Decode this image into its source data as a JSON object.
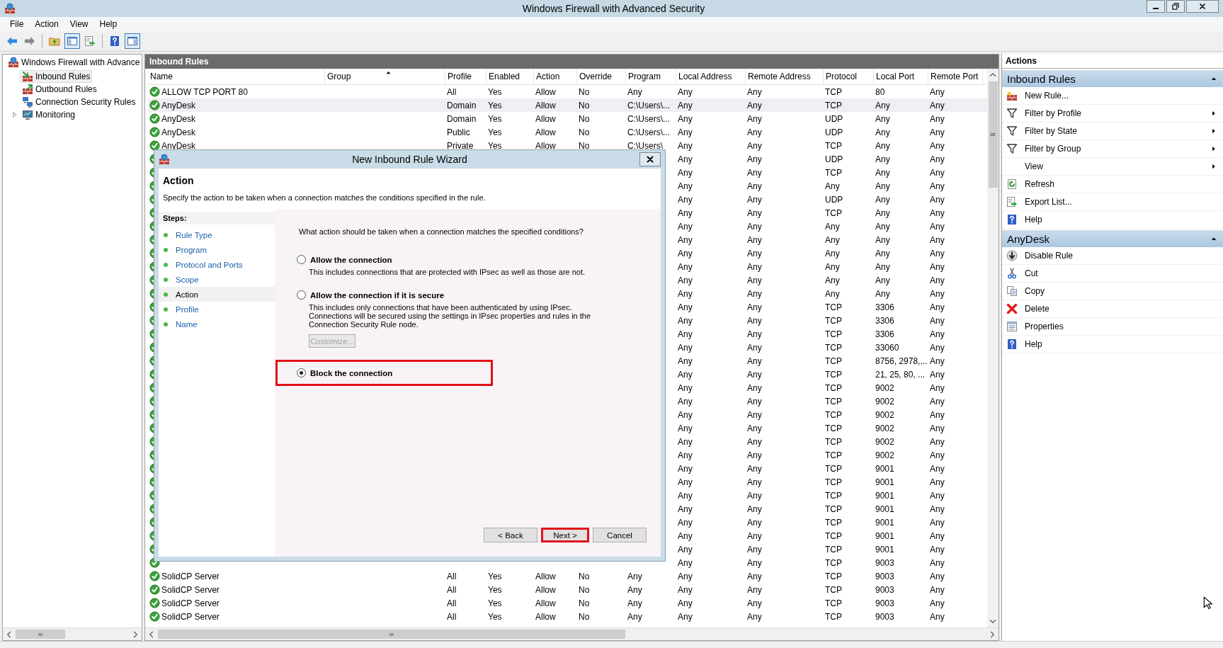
{
  "window": {
    "title": "Windows Firewall with Advanced Security"
  },
  "menu": [
    "File",
    "Action",
    "View",
    "Help"
  ],
  "toolbar": [
    [
      {
        "kind": "back",
        "pressed": false
      },
      {
        "kind": "forward",
        "pressed": false
      }
    ],
    [
      {
        "kind": "folder",
        "pressed": false
      },
      {
        "kind": "console-tree",
        "pressed": true
      },
      {
        "kind": "export",
        "pressed": false
      }
    ],
    [
      {
        "kind": "help",
        "pressed": false
      },
      {
        "kind": "action-pane",
        "pressed": true
      }
    ]
  ],
  "tree": [
    {
      "label": "Windows Firewall with Advance",
      "kind": "firewall",
      "selected": false,
      "children": [
        {
          "label": "Inbound Rules",
          "kind": "inbound",
          "selected": true,
          "expandable": false
        },
        {
          "label": "Outbound Rules",
          "kind": "outbound",
          "selected": false,
          "expandable": false
        },
        {
          "label": "Connection Security Rules",
          "kind": "security",
          "selected": false,
          "expandable": false
        },
        {
          "label": "Monitoring",
          "kind": "monitor",
          "selected": false,
          "expandable": true
        }
      ]
    }
  ],
  "table": {
    "title": "Inbound Rules",
    "columns": [
      {
        "label": "Name",
        "sorted": false
      },
      {
        "label": "Group",
        "sorted": true
      },
      {
        "label": "Profile",
        "sorted": false
      },
      {
        "label": "Enabled",
        "sorted": false
      },
      {
        "label": "Action",
        "sorted": false
      },
      {
        "label": "Override",
        "sorted": false
      },
      {
        "label": "Program",
        "sorted": false
      },
      {
        "label": "Local Address",
        "sorted": false
      },
      {
        "label": "Remote Address",
        "sorted": false
      },
      {
        "label": "Protocol",
        "sorted": false
      },
      {
        "label": "Local Port",
        "sorted": false
      },
      {
        "label": "Remote Port",
        "sorted": false
      }
    ],
    "rows": [
      {
        "name": "ALLOW TCP PORT 80",
        "profile": "All",
        "enabled": "Yes",
        "action": "Allow",
        "override": "No",
        "program": "Any",
        "local_address": "Any",
        "remote_address": "Any",
        "protocol": "TCP",
        "local_port": "80",
        "remote_port": "Any",
        "selected": false
      },
      {
        "name": "AnyDesk",
        "profile": "Domain",
        "enabled": "Yes",
        "action": "Allow",
        "override": "No",
        "program": "C:\\Users\\...",
        "local_address": "Any",
        "remote_address": "Any",
        "protocol": "TCP",
        "local_port": "Any",
        "remote_port": "Any",
        "selected": true
      },
      {
        "name": "AnyDesk",
        "profile": "Domain",
        "enabled": "Yes",
        "action": "Allow",
        "override": "No",
        "program": "C:\\Users\\...",
        "local_address": "Any",
        "remote_address": "Any",
        "protocol": "UDP",
        "local_port": "Any",
        "remote_port": "Any",
        "selected": false
      },
      {
        "name": "AnyDesk",
        "profile": "Public",
        "enabled": "Yes",
        "action": "Allow",
        "override": "No",
        "program": "C:\\Users\\...",
        "local_address": "Any",
        "remote_address": "Any",
        "protocol": "UDP",
        "local_port": "Any",
        "remote_port": "Any",
        "selected": false
      },
      {
        "name": "AnyDesk",
        "profile": "Private",
        "enabled": "Yes",
        "action": "Allow",
        "override": "No",
        "program": "C:\\Users\\",
        "local_address": "Any",
        "remote_address": "Any",
        "protocol": "TCP",
        "local_port": "Any",
        "remote_port": "Any",
        "selected": false
      },
      {
        "local_address": "Any",
        "remote_address": "Any",
        "protocol": "UDP",
        "local_port": "Any",
        "remote_port": "Any",
        "selected": false
      },
      {
        "local_address": "Any",
        "remote_address": "Any",
        "protocol": "TCP",
        "local_port": "Any",
        "remote_port": "Any",
        "selected": false
      },
      {
        "local_address": "Any",
        "remote_address": "Any",
        "protocol": "Any",
        "local_port": "Any",
        "remote_port": "Any",
        "selected": false
      },
      {
        "local_address": "Any",
        "remote_address": "Any",
        "protocol": "UDP",
        "local_port": "Any",
        "remote_port": "Any",
        "selected": false
      },
      {
        "local_address": "Any",
        "remote_address": "Any",
        "protocol": "TCP",
        "local_port": "Any",
        "remote_port": "Any",
        "selected": false
      },
      {
        "local_address": "Any",
        "remote_address": "Any",
        "protocol": "Any",
        "local_port": "Any",
        "remote_port": "Any",
        "selected": false
      },
      {
        "local_address": "Any",
        "remote_address": "Any",
        "protocol": "Any",
        "local_port": "Any",
        "remote_port": "Any",
        "selected": false
      },
      {
        "local_address": "Any",
        "remote_address": "Any",
        "protocol": "Any",
        "local_port": "Any",
        "remote_port": "Any",
        "selected": false
      },
      {
        "local_address": "Any",
        "remote_address": "Any",
        "protocol": "Any",
        "local_port": "Any",
        "remote_port": "Any",
        "selected": false
      },
      {
        "local_address": "Any",
        "remote_address": "Any",
        "protocol": "Any",
        "local_port": "Any",
        "remote_port": "Any",
        "selected": false
      },
      {
        "local_address": "Any",
        "remote_address": "Any",
        "protocol": "Any",
        "local_port": "Any",
        "remote_port": "Any",
        "selected": false
      },
      {
        "local_address": "Any",
        "remote_address": "Any",
        "protocol": "TCP",
        "local_port": "3306",
        "remote_port": "Any",
        "selected": false
      },
      {
        "local_address": "Any",
        "remote_address": "Any",
        "protocol": "TCP",
        "local_port": "3306",
        "remote_port": "Any",
        "selected": false
      },
      {
        "local_address": "Any",
        "remote_address": "Any",
        "protocol": "TCP",
        "local_port": "3306",
        "remote_port": "Any",
        "selected": false
      },
      {
        "local_address": "Any",
        "remote_address": "Any",
        "protocol": "TCP",
        "local_port": "33060",
        "remote_port": "Any",
        "selected": false
      },
      {
        "local_address": "Any",
        "remote_address": "Any",
        "protocol": "TCP",
        "local_port": "8756, 2978,...",
        "remote_port": "Any",
        "selected": false
      },
      {
        "local_address": "Any",
        "remote_address": "Any",
        "protocol": "TCP",
        "local_port": "21, 25, 80, ...",
        "remote_port": "Any",
        "selected": false
      },
      {
        "local_address": "Any",
        "remote_address": "Any",
        "protocol": "TCP",
        "local_port": "9002",
        "remote_port": "Any",
        "selected": false
      },
      {
        "local_address": "Any",
        "remote_address": "Any",
        "protocol": "TCP",
        "local_port": "9002",
        "remote_port": "Any",
        "selected": false
      },
      {
        "local_address": "Any",
        "remote_address": "Any",
        "protocol": "TCP",
        "local_port": "9002",
        "remote_port": "Any",
        "selected": false
      },
      {
        "local_address": "Any",
        "remote_address": "Any",
        "protocol": "TCP",
        "local_port": "9002",
        "remote_port": "Any",
        "selected": false
      },
      {
        "local_address": "Any",
        "remote_address": "Any",
        "protocol": "TCP",
        "local_port": "9002",
        "remote_port": "Any",
        "selected": false
      },
      {
        "local_address": "Any",
        "remote_address": "Any",
        "protocol": "TCP",
        "local_port": "9002",
        "remote_port": "Any",
        "selected": false
      },
      {
        "local_address": "Any",
        "remote_address": "Any",
        "protocol": "TCP",
        "local_port": "9001",
        "remote_port": "Any",
        "selected": false
      },
      {
        "local_address": "Any",
        "remote_address": "Any",
        "protocol": "TCP",
        "local_port": "9001",
        "remote_port": "Any",
        "selected": false
      },
      {
        "local_address": "Any",
        "remote_address": "Any",
        "protocol": "TCP",
        "local_port": "9001",
        "remote_port": "Any",
        "selected": false
      },
      {
        "local_address": "Any",
        "remote_address": "Any",
        "protocol": "TCP",
        "local_port": "9001",
        "remote_port": "Any",
        "selected": false
      },
      {
        "local_address": "Any",
        "remote_address": "Any",
        "protocol": "TCP",
        "local_port": "9001",
        "remote_port": "Any",
        "selected": false
      },
      {
        "local_address": "Any",
        "remote_address": "Any",
        "protocol": "TCP",
        "local_port": "9001",
        "remote_port": "Any",
        "selected": false
      },
      {
        "local_address": "Any",
        "remote_address": "Any",
        "protocol": "TCP",
        "local_port": "9001",
        "remote_port": "Any",
        "selected": false
      },
      {
        "local_address": "Any",
        "remote_address": "Any",
        "protocol": "TCP",
        "local_port": "9003",
        "remote_port": "Any",
        "selected": false
      },
      {
        "name": "SolidCP Server",
        "profile": "All",
        "enabled": "Yes",
        "action": "Allow",
        "override": "No",
        "program": "Any",
        "local_address": "Any",
        "remote_address": "Any",
        "protocol": "TCP",
        "local_port": "9003",
        "remote_port": "Any",
        "selected": false
      },
      {
        "name": "SolidCP Server",
        "profile": "All",
        "enabled": "Yes",
        "action": "Allow",
        "override": "No",
        "program": "Any",
        "local_address": "Any",
        "remote_address": "Any",
        "protocol": "TCP",
        "local_port": "9003",
        "remote_port": "Any",
        "selected": false
      },
      {
        "name": "SolidCP Server",
        "profile": "All",
        "enabled": "Yes",
        "action": "Allow",
        "override": "No",
        "program": "Any",
        "local_address": "Any",
        "remote_address": "Any",
        "protocol": "TCP",
        "local_port": "9003",
        "remote_port": "Any",
        "selected": false
      },
      {
        "name": "SolidCP Server",
        "profile": "All",
        "enabled": "Yes",
        "action": "Allow",
        "override": "No",
        "program": "Any",
        "local_address": "Any",
        "remote_address": "Any",
        "protocol": "TCP",
        "local_port": "9003",
        "remote_port": "Any",
        "selected": false
      }
    ]
  },
  "actions": {
    "title": "Actions",
    "sections": [
      {
        "title": "Inbound Rules",
        "expanded": true,
        "items": [
          {
            "label": "New Rule...",
            "kind": "new-rule",
            "submenu": false
          },
          {
            "label": "Filter by Profile",
            "kind": "filter",
            "submenu": true
          },
          {
            "label": "Filter by State",
            "kind": "filter",
            "submenu": true
          },
          {
            "label": "Filter by Group",
            "kind": "filter",
            "submenu": true
          },
          {
            "label": "View",
            "kind": "view",
            "submenu": true
          },
          {
            "label": "Refresh",
            "kind": "refresh",
            "submenu": false
          },
          {
            "label": "Export List...",
            "kind": "export",
            "submenu": false
          },
          {
            "label": "Help",
            "kind": "help",
            "submenu": false
          }
        ]
      },
      {
        "title": "AnyDesk",
        "expanded": true,
        "items": [
          {
            "label": "Disable Rule",
            "kind": "disable",
            "submenu": false
          },
          {
            "label": "Cut",
            "kind": "cut",
            "submenu": false
          },
          {
            "label": "Copy",
            "kind": "copy",
            "submenu": false
          },
          {
            "label": "Delete",
            "kind": "delete",
            "submenu": false
          },
          {
            "label": "Properties",
            "kind": "properties",
            "submenu": false
          },
          {
            "label": "Help",
            "kind": "help",
            "submenu": false
          }
        ]
      }
    ]
  },
  "dialog": {
    "title": "New Inbound Rule Wizard",
    "heading": "Action",
    "description": "Specify the action to be taken when a connection matches the conditions specified in the rule.",
    "steps_title": "Steps:",
    "steps": [
      {
        "label": "Rule Type",
        "selected": false
      },
      {
        "label": "Program",
        "selected": false
      },
      {
        "label": "Protocol and Ports",
        "selected": false
      },
      {
        "label": "Scope",
        "selected": false
      },
      {
        "label": "Action",
        "selected": true
      },
      {
        "label": "Profile",
        "selected": false
      },
      {
        "label": "Name",
        "selected": false
      }
    ],
    "question": "What action should be taken when a connection matches the specified conditions?",
    "options": [
      {
        "title": "Allow the connection",
        "description": "This includes connections that are protected with IPsec as well as those are not.",
        "selected": false,
        "highlighted": false
      },
      {
        "title": "Allow the connection if it is secure",
        "description": "This includes only connections that have been authenticated by using IPsec.  Connections will be secured using the settings in IPsec properties and rules in the Connection Security Rule node.",
        "selected": false,
        "highlighted": false,
        "button": {
          "label": "Customize...",
          "disabled": true
        }
      },
      {
        "title": "Block the connection",
        "selected": true,
        "highlighted": true
      }
    ],
    "buttons": [
      {
        "label": "< Back",
        "highlighted": false
      },
      {
        "label": "Next >",
        "highlighted": true
      },
      {
        "label": "Cancel",
        "highlighted": false
      }
    ]
  }
}
